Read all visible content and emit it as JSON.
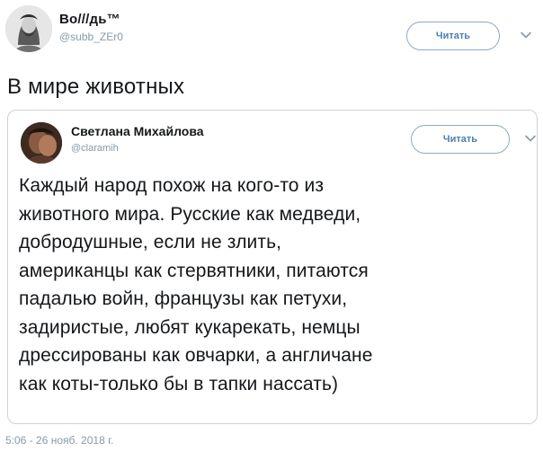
{
  "tweet": {
    "author": {
      "display_name": "Во///дь™",
      "handle": "@subb_ZEr0",
      "avatar_icon": "bearded-man-portrait-avatar"
    },
    "follow_label": "Читать",
    "menu_icon": "chevron-down-icon",
    "text": "В мире животных",
    "timestamp": "5:06 - 26 нояб. 2018 г."
  },
  "quoted_tweet": {
    "author": {
      "display_name": "Светлана Михайлова",
      "handle": "@claramih",
      "avatar_icon": "photo-avatar"
    },
    "follow_label": "Читать",
    "menu_icon": "chevron-down-icon",
    "lines": [
      "Каждый народ похож на кого-то из",
      "животного мира. Русские как медведи,",
      "добродушные,  если не злить,",
      "американцы как стервятники,  питаются",
      "падалью войн,  французы как петухи,",
      "задиристые,  любят кукарекать,  немцы",
      "дрессированы как овчарки,  а англичане",
      "как коты-только бы в тапки нассать)"
    ]
  },
  "colors": {
    "text_primary": "#14171a",
    "text_secondary": "#8899a6",
    "button_border": "#8fa9c4",
    "button_text": "#4a7fb0",
    "card_border": "#c9d3dc"
  }
}
